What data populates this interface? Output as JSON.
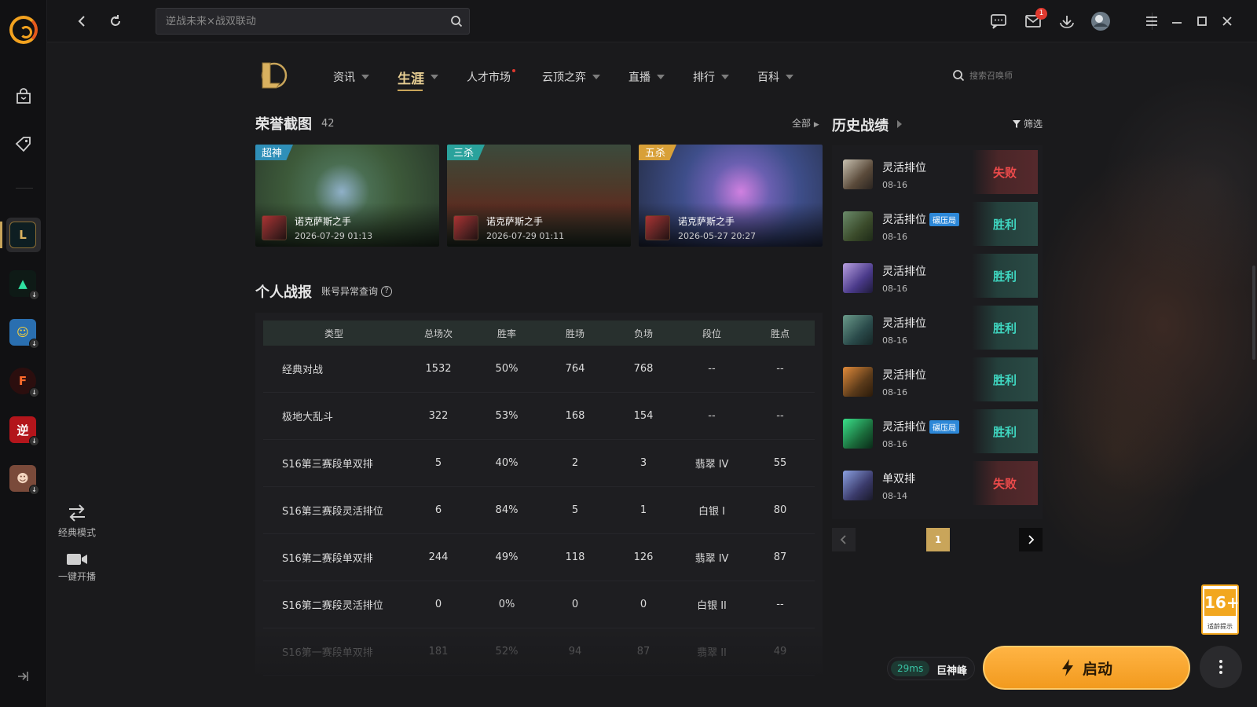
{
  "topbar": {
    "search_placeholder": "逆战未来×战双联动",
    "mail_badge": "1"
  },
  "nav": {
    "items": [
      {
        "label": "资讯"
      },
      {
        "label": "生涯"
      },
      {
        "label": "人才市场"
      },
      {
        "label": "云顶之弈"
      },
      {
        "label": "直播"
      },
      {
        "label": "排行"
      },
      {
        "label": "百科"
      }
    ],
    "summoner_search_placeholder": "搜索召唤师"
  },
  "honor": {
    "title": "荣誉截图",
    "count": "42",
    "all_label": "全部",
    "shots": [
      {
        "tag": "超神",
        "name": "诺克萨斯之手",
        "date": "2026-07-29 01:13"
      },
      {
        "tag": "三杀",
        "name": "诺克萨斯之手",
        "date": "2026-07-29 01:11"
      },
      {
        "tag": "五杀",
        "name": "诺克萨斯之手",
        "date": "2026-05-27 20:27"
      }
    ]
  },
  "stats": {
    "title": "个人战报",
    "abnormal_link": "账号异常查询",
    "help": "?",
    "headers": [
      "类型",
      "总场次",
      "胜率",
      "胜场",
      "负场",
      "段位",
      "胜点"
    ],
    "rows": [
      [
        "经典对战",
        "1532",
        "50%",
        "764",
        "768",
        "--",
        "--"
      ],
      [
        "极地大乱斗",
        "322",
        "53%",
        "168",
        "154",
        "--",
        "--"
      ],
      [
        "S16第三赛段单双排",
        "5",
        "40%",
        "2",
        "3",
        "翡翠 IV",
        "55"
      ],
      [
        "S16第三赛段灵活排位",
        "6",
        "84%",
        "5",
        "1",
        "白银 I",
        "80"
      ],
      [
        "S16第二赛段单双排",
        "244",
        "49%",
        "118",
        "126",
        "翡翠 IV",
        "87"
      ],
      [
        "S16第二赛段灵活排位",
        "0",
        "0%",
        "0",
        "0",
        "白银 II",
        "--"
      ],
      [
        "S16第一赛段单双排",
        "181",
        "52%",
        "94",
        "87",
        "翡翠 II",
        "49"
      ]
    ]
  },
  "history": {
    "title": "历史战绩",
    "filter_label": "筛选",
    "matches": [
      {
        "mode": "灵活排位",
        "tag": "",
        "date": "08-16",
        "result": "失败",
        "win": false
      },
      {
        "mode": "灵活排位",
        "tag": "碾压局",
        "date": "08-16",
        "result": "胜利",
        "win": true
      },
      {
        "mode": "灵活排位",
        "tag": "",
        "date": "08-16",
        "result": "胜利",
        "win": true
      },
      {
        "mode": "灵活排位",
        "tag": "",
        "date": "08-16",
        "result": "胜利",
        "win": true
      },
      {
        "mode": "灵活排位",
        "tag": "",
        "date": "08-16",
        "result": "胜利",
        "win": true
      },
      {
        "mode": "灵活排位",
        "tag": "碾压局",
        "date": "08-16",
        "result": "胜利",
        "win": true
      },
      {
        "mode": "单双排",
        "tag": "",
        "date": "08-14",
        "result": "失败",
        "win": false
      }
    ],
    "page": "1"
  },
  "tools": {
    "classic_mode": "经典模式",
    "one_click_live": "一键开播"
  },
  "bottom": {
    "ping": "29ms",
    "server": "巨神峰",
    "launch": "启动",
    "age_rating": "16+",
    "age_text": "适龄提示"
  },
  "rail": {
    "games": [
      {
        "name": "lol",
        "glyph": "L"
      },
      {
        "name": "valorant",
        "glyph": "▲"
      },
      {
        "name": "qq-speed",
        "glyph": "☺"
      },
      {
        "name": "crossfire",
        "glyph": "F"
      },
      {
        "name": "nizhan",
        "glyph": "逆"
      },
      {
        "name": "other-game",
        "glyph": "☻"
      }
    ]
  }
}
